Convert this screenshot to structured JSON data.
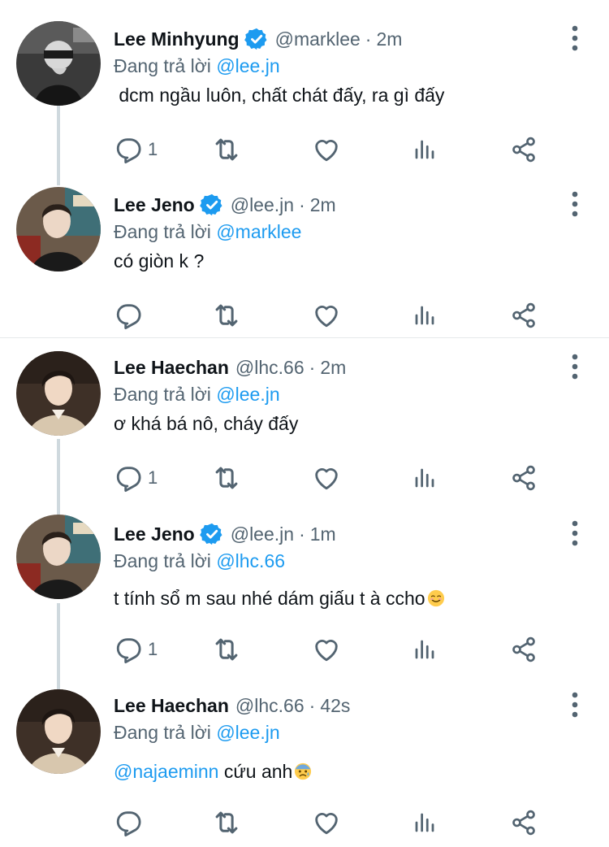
{
  "colors": {
    "accent": "#1d9bf0",
    "muted": "#536471",
    "text": "#0f1419",
    "thread_line": "#cfd9de"
  },
  "icons": {
    "verified": "verified-badge-icon",
    "reply": "reply-icon",
    "retweet": "retweet-icon",
    "like": "like-icon",
    "views": "views-icon",
    "share": "share-icon",
    "more": "more-vertical-icon"
  },
  "tweets": [
    {
      "name": "Lee Minhyung",
      "verified": true,
      "handle": "@marklee",
      "dot": "·",
      "time": "2m",
      "reply_prefix": "Đang trả lời",
      "reply_to": "@lee.jn",
      "text": " dcm ngầu luôn, chất chát đấy, ra gì đấy",
      "reply_count": "1"
    },
    {
      "name": "Lee Jeno",
      "verified": true,
      "handle": "@lee.jn",
      "dot": "·",
      "time": "2m",
      "reply_prefix": "Đang trả lời",
      "reply_to": "@marklee",
      "text": "có giòn k ?",
      "reply_count": ""
    },
    {
      "name": "Lee Haechan",
      "verified": false,
      "handle": "@lhc.66",
      "dot": "·",
      "time": "2m",
      "reply_prefix": "Đang trả lời",
      "reply_to": "@lee.jn",
      "text": "ơ khá bá nô, cháy đấy",
      "reply_count": "1"
    },
    {
      "name": "Lee Jeno",
      "verified": true,
      "handle": "@lee.jn",
      "dot": "·",
      "time": "1m",
      "reply_prefix": "Đang trả lời",
      "reply_to": "@lhc.66",
      "text": "t tính sổ m sau nhé dám giấu t à ccho",
      "text_emoji": "smiling-face-emoji",
      "reply_count": "1"
    },
    {
      "name": "Lee Haechan",
      "verified": false,
      "handle": "@lhc.66",
      "dot": "·",
      "time": "42s",
      "reply_prefix": "Đang trả lời",
      "reply_to": "@lee.jn",
      "text_mention": "@najaeminn",
      "text": " cứu anh",
      "text_emoji": "anxious-face-emoji",
      "reply_count": ""
    }
  ]
}
